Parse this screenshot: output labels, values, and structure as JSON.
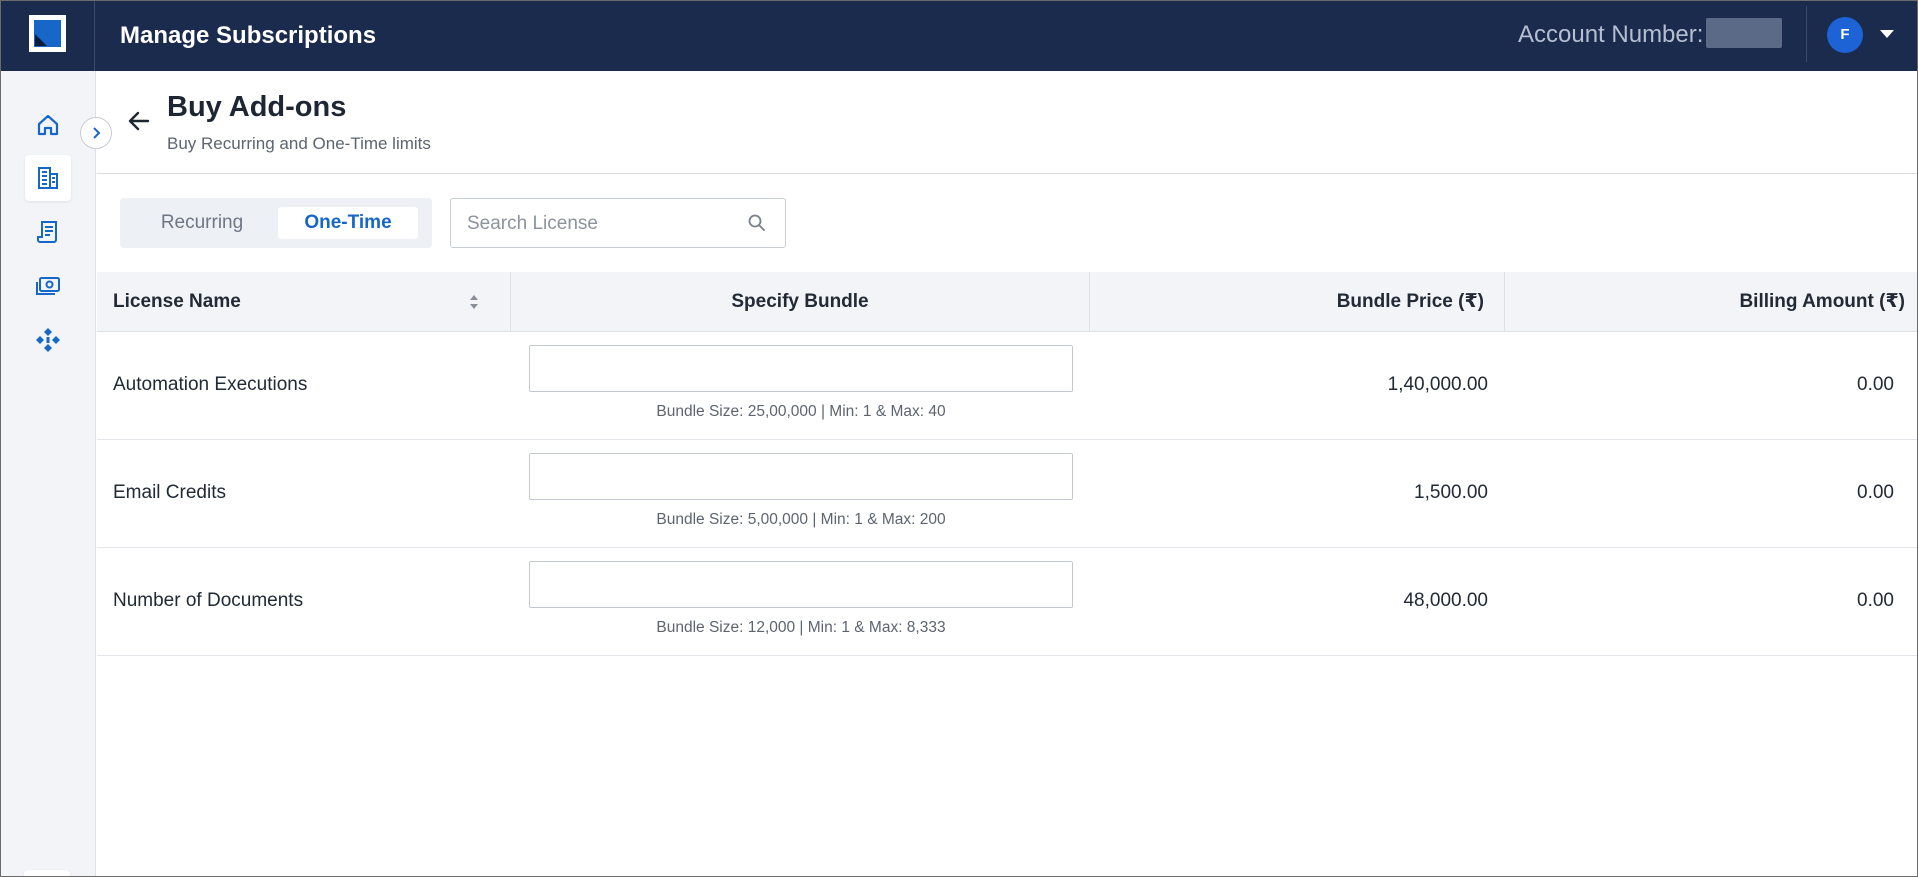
{
  "header": {
    "app_title": "Manage Subscriptions",
    "account_label": "Account Number:",
    "avatar_initial": "F"
  },
  "sidebar": {
    "items": [
      {
        "icon": "home-icon",
        "active": false
      },
      {
        "icon": "building-icon",
        "active": true
      },
      {
        "icon": "invoice-icon",
        "active": false
      },
      {
        "icon": "payment-icon",
        "active": false
      },
      {
        "icon": "integration-icon",
        "active": false
      }
    ],
    "bottom_icon": "mail-icon"
  },
  "page": {
    "title": "Buy Add-ons",
    "subtitle": "Buy Recurring and One-Time limits"
  },
  "tabs": {
    "recurring": "Recurring",
    "one_time": "One-Time",
    "selected": "One-Time"
  },
  "search": {
    "placeholder": "Search License",
    "value": ""
  },
  "table": {
    "columns": {
      "license_name": "License Name",
      "specify_bundle": "Specify Bundle",
      "bundle_price": "Bundle Price (₹)",
      "billing_amount": "Billing Amount (₹)"
    },
    "rows": [
      {
        "name": "Automation Executions",
        "bundle_value": "",
        "hint": "Bundle Size: 25,00,000 | Min: 1 & Max: 40",
        "price": "1,40,000.00",
        "amount": "0.00"
      },
      {
        "name": "Email Credits",
        "bundle_value": "",
        "hint": "Bundle Size: 5,00,000 | Min: 1 & Max: 200",
        "price": "1,500.00",
        "amount": "0.00"
      },
      {
        "name": "Number of Documents",
        "bundle_value": "",
        "hint": "Bundle Size: 12,000 | Min: 1 & Max: 8,333",
        "price": "48,000.00",
        "amount": "0.00"
      }
    ]
  },
  "colors": {
    "topbar": "#1b2b4d",
    "accent": "#1767c9",
    "avatar": "#1d63d5"
  }
}
